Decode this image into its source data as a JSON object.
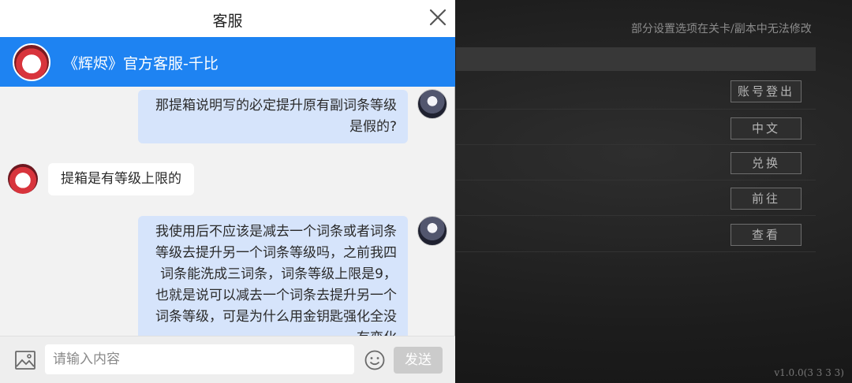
{
  "background_game": {
    "notice": "部分设置选项在关卡/副本中无法修改",
    "buttons": [
      "账号登出",
      "中文",
      "兑换",
      "前往",
      "查看"
    ],
    "version": "v1.0.0(3 3 3 3)"
  },
  "chat": {
    "title": "客服",
    "agent_name": "《辉烬》官方客服-千比",
    "messages": [
      {
        "sender": "user",
        "text": "那提箱说明写的必定提升原有副词条等级是假的?"
      },
      {
        "sender": "agent",
        "text": "提箱是有等级上限的"
      },
      {
        "sender": "user",
        "text": "我使用后不应该是减去一个词条或者词条等级去提升另一个词条等级吗，之前我四词条能洗成三词条，词条等级上限是9，也就是说可以减去一个词条去提升另一个词条等级，可是为什么用金钥匙强化全没有变化"
      }
    ],
    "input_placeholder": "请输入内容",
    "send_label": "发送"
  },
  "colors": {
    "banner": "#1e83f2",
    "user_bubble": "#d6e4fb",
    "send_disabled": "#cbcbcb"
  },
  "icons": [
    "close-icon",
    "image-icon",
    "emoji-icon"
  ]
}
